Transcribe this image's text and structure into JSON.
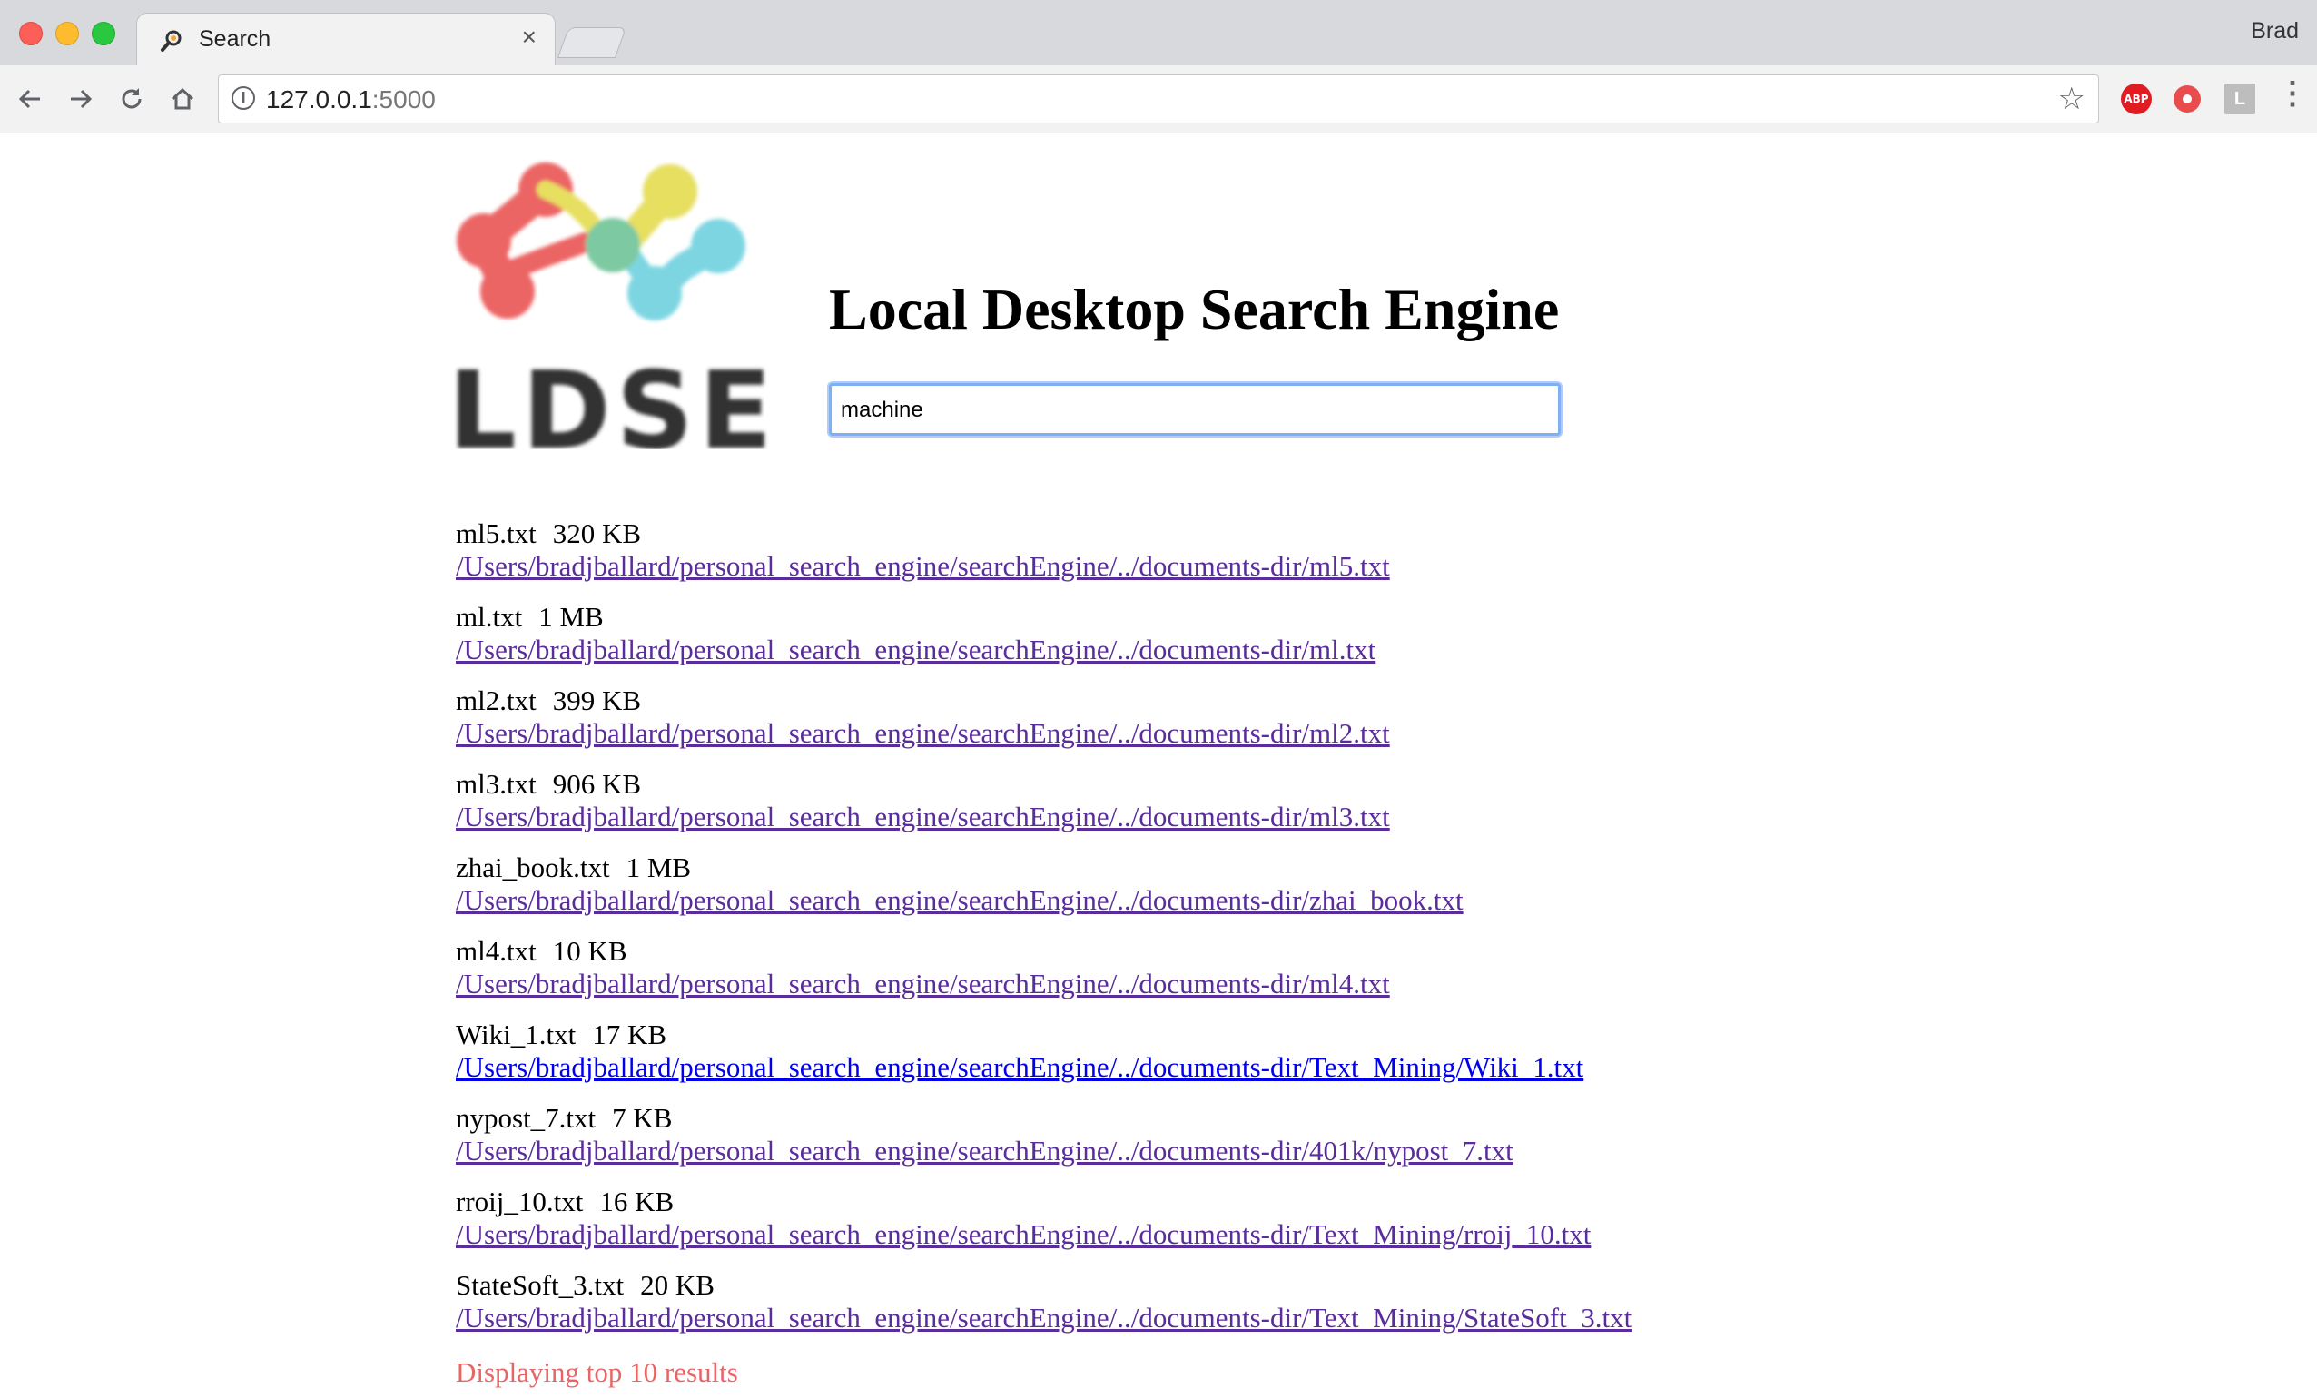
{
  "browser": {
    "tab_title": "Search",
    "tab_close": "×",
    "profile_name": "Brad",
    "url_host": "127.0.0.1",
    "url_port": ":5000",
    "extensions": {
      "abp_label": "ABP",
      "l_label": "L"
    }
  },
  "header": {
    "title": "Local Desktop Search Engine",
    "logo_text": "LDSE"
  },
  "search": {
    "value": "machine"
  },
  "results": [
    {
      "name": "ml5.txt",
      "size": "320 KB",
      "path": "/Users/bradjballard/personal_search_engine/searchEngine/../documents-dir/ml5.txt"
    },
    {
      "name": "ml.txt",
      "size": "1 MB",
      "path": "/Users/bradjballard/personal_search_engine/searchEngine/../documents-dir/ml.txt"
    },
    {
      "name": "ml2.txt",
      "size": "399 KB",
      "path": "/Users/bradjballard/personal_search_engine/searchEngine/../documents-dir/ml2.txt"
    },
    {
      "name": "ml3.txt",
      "size": "906 KB",
      "path": "/Users/bradjballard/personal_search_engine/searchEngine/../documents-dir/ml3.txt"
    },
    {
      "name": "zhai_book.txt",
      "size": "1 MB",
      "path": "/Users/bradjballard/personal_search_engine/searchEngine/../documents-dir/zhai_book.txt"
    },
    {
      "name": "ml4.txt",
      "size": "10 KB",
      "path": "/Users/bradjballard/personal_search_engine/searchEngine/../documents-dir/ml4.txt"
    },
    {
      "name": "Wiki_1.txt",
      "size": "17 KB",
      "path": "/Users/bradjballard/personal_search_engine/searchEngine/../documents-dir/Text_Mining/Wiki_1.txt"
    },
    {
      "name": "nypost_7.txt",
      "size": "7 KB",
      "path": "/Users/bradjballard/personal_search_engine/searchEngine/../documents-dir/401k/nypost_7.txt"
    },
    {
      "name": "rroij_10.txt",
      "size": "16 KB",
      "path": "/Users/bradjballard/personal_search_engine/searchEngine/../documents-dir/Text_Mining/rroij_10.txt"
    },
    {
      "name": "StateSoft_3.txt",
      "size": "20 KB",
      "path": "/Users/bradjballard/personal_search_engine/searchEngine/../documents-dir/Text_Mining/StateSoft_3.txt"
    }
  ],
  "footer": {
    "note": "Displaying top 10 results"
  },
  "colors": {
    "visited_link": "#5a2c9c",
    "unvisited_link": "#0000ee",
    "note": "#e86565",
    "logo_red": "#ea5455",
    "logo_yellow": "#e4dc50",
    "logo_green": "#6fc497",
    "logo_cyan": "#6fd1df",
    "logo_text": "#333333"
  }
}
